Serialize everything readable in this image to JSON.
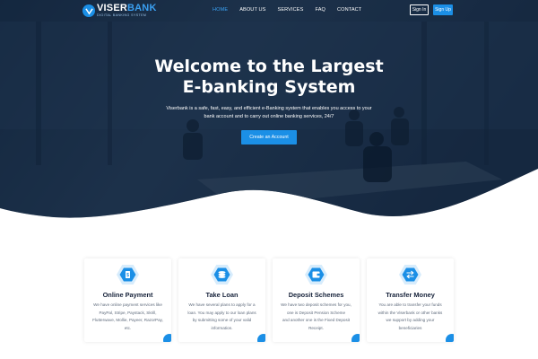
{
  "brand": {
    "name_part1": "VISER",
    "name_part2": "BANK",
    "tagline": "DIGITAL BANKING SYSTEM"
  },
  "nav": {
    "items": [
      "HOME",
      "ABOUT US",
      "SERVICES",
      "FAQ",
      "CONTACT"
    ],
    "active": "HOME",
    "sign_in": "Sign In",
    "sign_up": "Sign Up"
  },
  "hero": {
    "title_line1": "Welcome to the Largest",
    "title_line2": "E-banking System",
    "description_line1": "Viserbank is a safe, fast, easy, and efficient e-Banking system that enables you access to your",
    "description_line2": "bank account and to carry out online banking services, 24/7",
    "cta": "Create an Account"
  },
  "features": [
    {
      "title": "Online Payment",
      "icon": "payment-icon",
      "lines": [
        "We have online payment services like",
        "PayPal, Stripe, Paystack, Skrill,",
        "Flutterwave, Mollie, Payeer, RazorPay,",
        "etc."
      ]
    },
    {
      "title": "Take Loan",
      "icon": "coins-icon",
      "lines": [
        "We have several plans to apply for a",
        "loan. You may apply to our loan plans",
        "by submitting some of your valid",
        "information."
      ]
    },
    {
      "title": "Deposit Schemes",
      "icon": "wallet-icon",
      "lines": [
        "We have two deposit schemes for you,",
        "one is Deposit Pension Scheme",
        "and another one is the Fixed Deposit",
        "Receipt."
      ]
    },
    {
      "title": "Transfer Money",
      "icon": "transfer-icon",
      "lines": [
        "You are able to transfer your funds",
        "within the Viserbank or other banks",
        "we support by adding your",
        "beneficiaries"
      ]
    }
  ],
  "colors": {
    "primary": "#1b8fe6",
    "hero_overlay": "#0b2340",
    "heading": "#16223a",
    "body_text": "#5f6b7c"
  }
}
